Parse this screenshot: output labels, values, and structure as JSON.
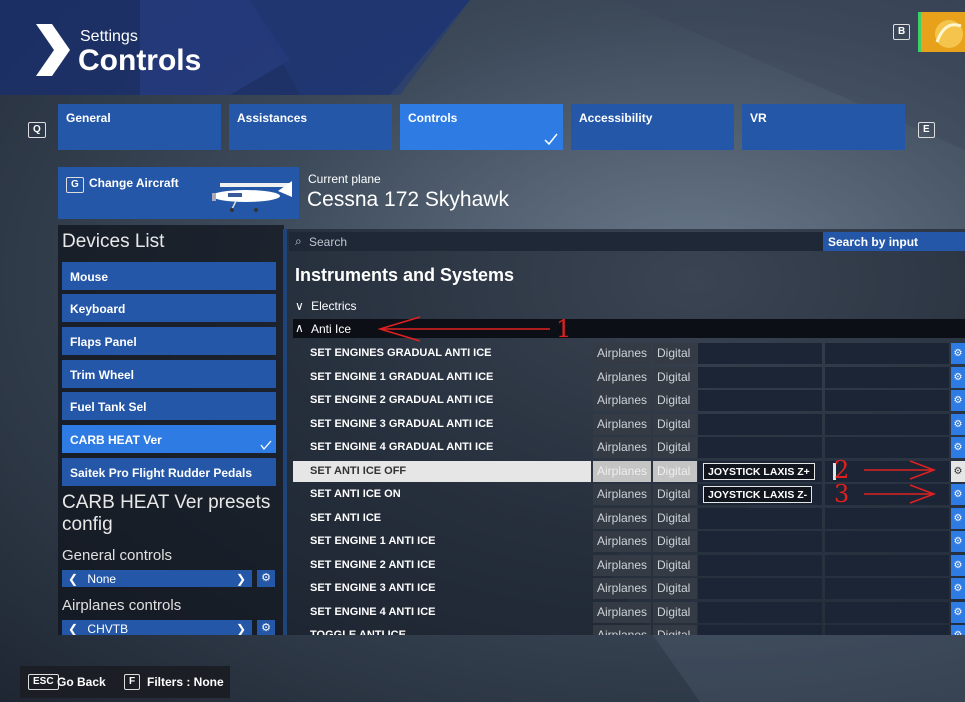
{
  "header": {
    "subtitle": "Settings",
    "title": "Controls",
    "key_b": "B"
  },
  "tabs": {
    "key_left": "Q",
    "key_right": "E",
    "items": [
      {
        "label": "General"
      },
      {
        "label": "Assistances"
      },
      {
        "label": "Controls"
      },
      {
        "label": "Accessibility"
      },
      {
        "label": "VR"
      }
    ]
  },
  "aircraft": {
    "key": "G",
    "button_label": "Change Aircraft",
    "current_label": "Current plane",
    "current_name": "Cessna 172 Skyhawk"
  },
  "devices": {
    "title": "Devices List",
    "items": [
      {
        "label": "Mouse"
      },
      {
        "label": "Keyboard"
      },
      {
        "label": "Flaps Panel"
      },
      {
        "label": "Trim Wheel"
      },
      {
        "label": "Fuel Tank Sel"
      },
      {
        "label": "CARB HEAT Ver"
      },
      {
        "label": "Saitek Pro Flight Rudder Pedals"
      }
    ],
    "presets_title": "CARB HEAT Ver presets config",
    "general_label": "General controls",
    "general_value": "None",
    "airplanes_label": "Airplanes controls",
    "airplanes_value": "CHVTB"
  },
  "search": {
    "placeholder": "Search",
    "mode": "Search by input"
  },
  "section": {
    "title": "Instruments and Systems",
    "group_electrics": "Electrics",
    "group_antiice": "Anti Ice"
  },
  "bindings": {
    "category": "Airplanes",
    "type": "Digital",
    "rows": [
      {
        "name": "SET ENGINES GRADUAL ANTI ICE",
        "input1": "",
        "input2": ""
      },
      {
        "name": "SET ENGINE 1 GRADUAL ANTI ICE",
        "input1": "",
        "input2": ""
      },
      {
        "name": "SET ENGINE 2 GRADUAL ANTI ICE",
        "input1": "",
        "input2": ""
      },
      {
        "name": "SET ENGINE 3 GRADUAL ANTI ICE",
        "input1": "",
        "input2": ""
      },
      {
        "name": "SET ENGINE 4 GRADUAL ANTI ICE",
        "input1": "",
        "input2": ""
      },
      {
        "name": "SET ANTI ICE OFF",
        "input1": "JOYSTICK LAXIS Z+",
        "input2": ""
      },
      {
        "name": "SET ANTI ICE ON",
        "input1": "JOYSTICK LAXIS Z-",
        "input2": ""
      },
      {
        "name": "SET ANTI ICE",
        "input1": "",
        "input2": ""
      },
      {
        "name": "SET ENGINE 1 ANTI ICE",
        "input1": "",
        "input2": ""
      },
      {
        "name": "SET ENGINE 2 ANTI ICE",
        "input1": "",
        "input2": ""
      },
      {
        "name": "SET ENGINE 3 ANTI ICE",
        "input1": "",
        "input2": ""
      },
      {
        "name": "SET ENGINE 4 ANTI ICE",
        "input1": "",
        "input2": ""
      },
      {
        "name": "TOGGLE ANTI ICE",
        "input1": "",
        "input2": ""
      }
    ]
  },
  "annotations": {
    "n1": "1",
    "n2": "2",
    "n3": "3"
  },
  "footer": {
    "esc_key": "ESC",
    "back_label": "Go Back",
    "f_key": "F",
    "filters_label": "Filters : None"
  },
  "colors": {
    "tab": "#2457a8",
    "tab_active": "#2e7be4",
    "annotation": "#e02020"
  }
}
